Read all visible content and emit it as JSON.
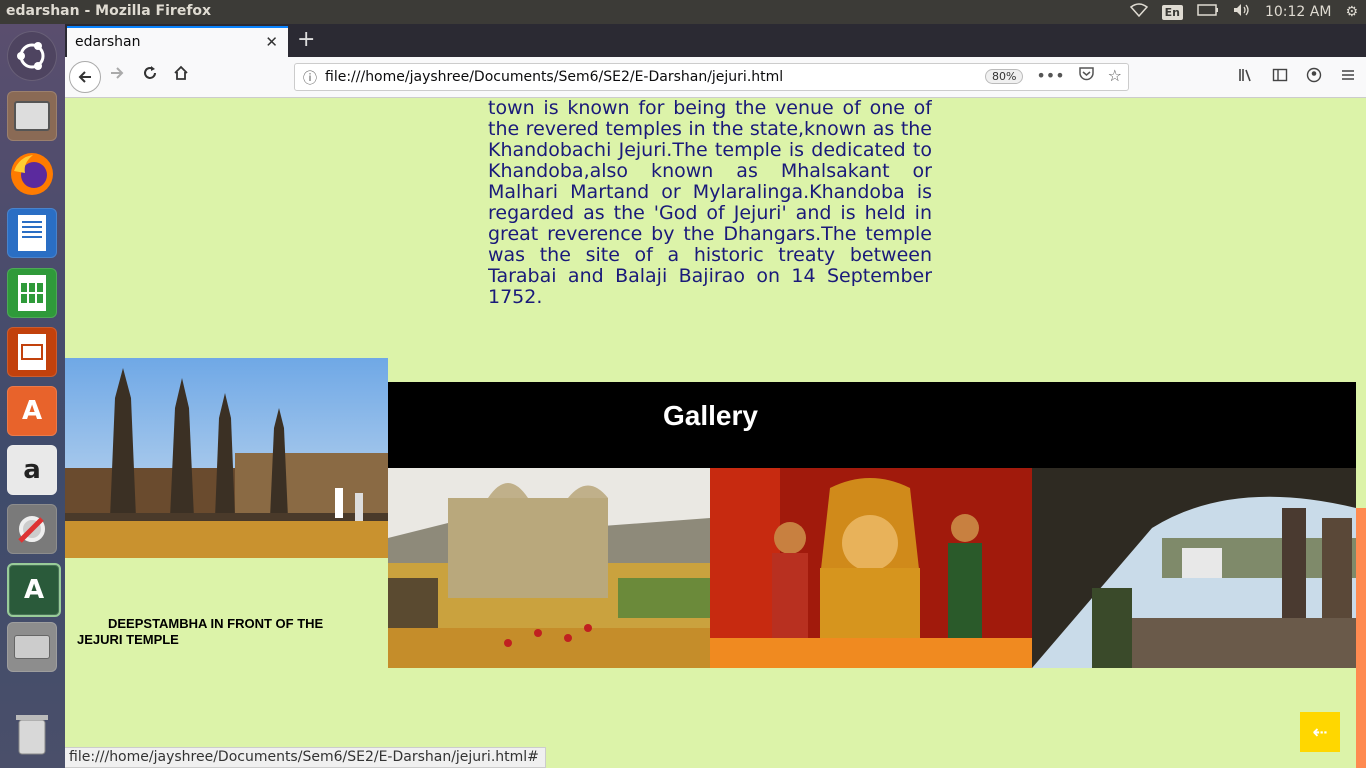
{
  "system_bar": {
    "window_title": "edarshan - Mozilla Firefox",
    "keyboard": "En",
    "clock": "10:12 AM"
  },
  "launcher": {
    "items": [
      "ubuntu-icon",
      "files-icon",
      "firefox-icon",
      "writer-icon",
      "calc-icon",
      "impress-icon",
      "software-center-icon",
      "amazon-icon",
      "settings-icon",
      "software-updater-icon",
      "disk-icon",
      "trash-icon"
    ]
  },
  "browser": {
    "tab_title": "edarshan",
    "url": "file:///home/jayshree/Documents/Sem6/SE2/E-Darshan/jejuri.html",
    "zoom": "80%",
    "status_url": "file:///home/jayshree/Documents/Sem6/SE2/E-Darshan/jejuri.html#"
  },
  "page": {
    "description": "town is known for being the venue of one of the revered temples in the state,known as the Khandobachi Jejuri.The temple is dedicated to Khandoba,also known as Mhalsakant or Malhari Martand or Mylaralinga.Khandoba is regarded as the 'God of Jejuri' and is held in great reverence by the Dhangars.The temple was the site of a historic treaty between Tarabai and Balaji Bajirao on 14 September 1752.",
    "photo_caption": "DEEPSTAMBHA IN FRONT OF THE JEJURI TEMPLE",
    "gallery_title": "Gallery",
    "back_to_top": "⇠"
  },
  "colors": {
    "page_bg": "#dcf3a9",
    "text": "#1a1a7a",
    "gallery_bar": "#000000",
    "scroll_thumb": "#ff8a50",
    "top_button": "#ffd700"
  }
}
